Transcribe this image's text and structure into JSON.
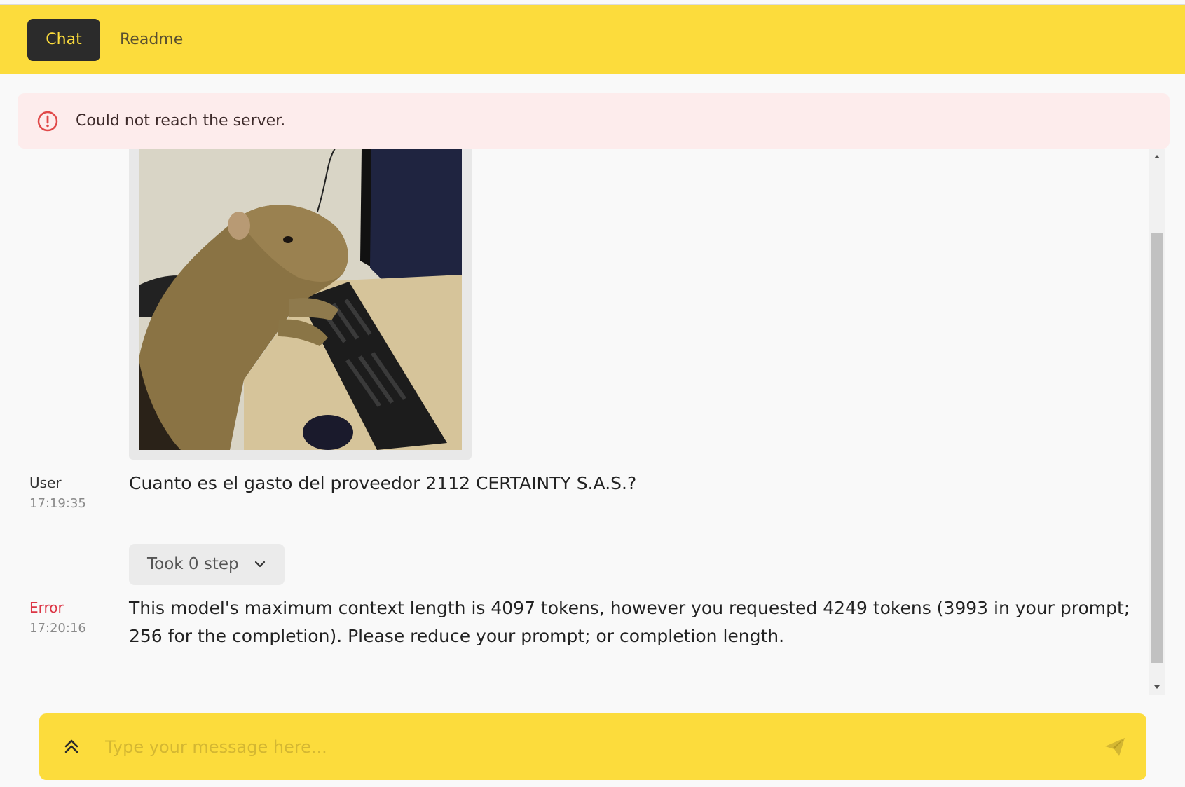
{
  "nav": {
    "tabs": [
      {
        "label": "Chat",
        "active": true
      },
      {
        "label": "Readme",
        "active": false
      }
    ]
  },
  "alert": {
    "message": "Could not reach the server.",
    "icon": "alert-circle-icon"
  },
  "messages": [
    {
      "role": "User",
      "time": "17:19:35",
      "text": "Cuanto es el gasto del proveedor 2112 CERTAINTY S.A.S.?",
      "steps_label": "Took 0 step"
    },
    {
      "role": "Error",
      "time": "17:20:16",
      "text_line1": "This model's maximum context length is 4097 tokens, however you requested 4249 tokens (3993 in your prompt;",
      "text_line2": "256 for the completion). Please reduce your prompt; or completion length."
    }
  ],
  "composer": {
    "placeholder": "Type your message here..."
  },
  "colors": {
    "accent": "#fcdc3c",
    "dark": "#2b2b2b",
    "error": "#dc3545"
  }
}
